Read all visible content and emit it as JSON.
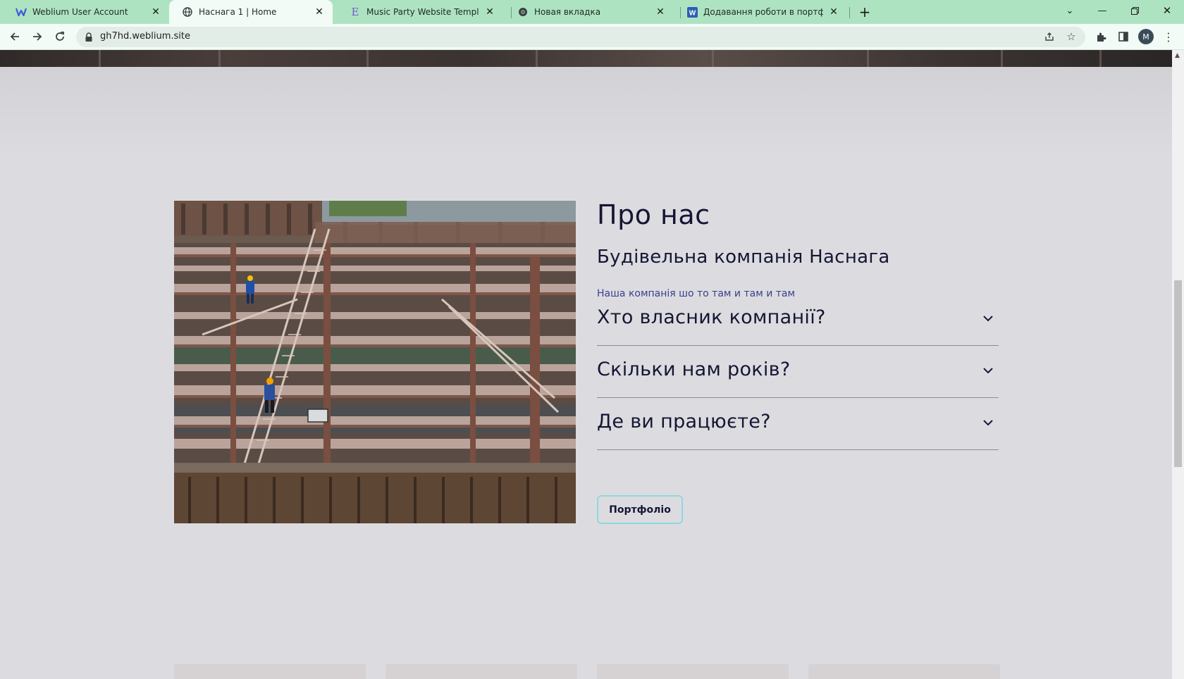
{
  "browser": {
    "tabs": [
      {
        "title": "Weblium User Account",
        "icon": "weblium-icon",
        "active": false
      },
      {
        "title": "Наснага 1 | Home",
        "icon": "globe-icon",
        "active": true
      },
      {
        "title": "Music Party Website Template De",
        "icon": "elementor-icon",
        "active": false
      },
      {
        "title": "Новая вкладка",
        "icon": "chrome-icon",
        "active": false
      },
      {
        "title": "Додавання роботи в портфоліо",
        "icon": "word-icon",
        "active": false
      }
    ],
    "url": "gh7hd.weblium.site",
    "profile_initial": "M",
    "theme_color": "#aee3c2"
  },
  "page": {
    "about": {
      "title": "Про нас",
      "subtitle": "Будівельна компанія Наснага",
      "description": "Наша компанія шо то там и там и там",
      "faq": [
        {
          "question": "Хто власник компанії?"
        },
        {
          "question": "Скільки нам років?"
        },
        {
          "question": "Де ви працюєте?"
        }
      ],
      "button_label": "Портфоліо",
      "button_border_color": "#8fd8de",
      "text_color": "#141633",
      "description_color": "#3a3f8f"
    },
    "background_color": "#dcdce0"
  }
}
